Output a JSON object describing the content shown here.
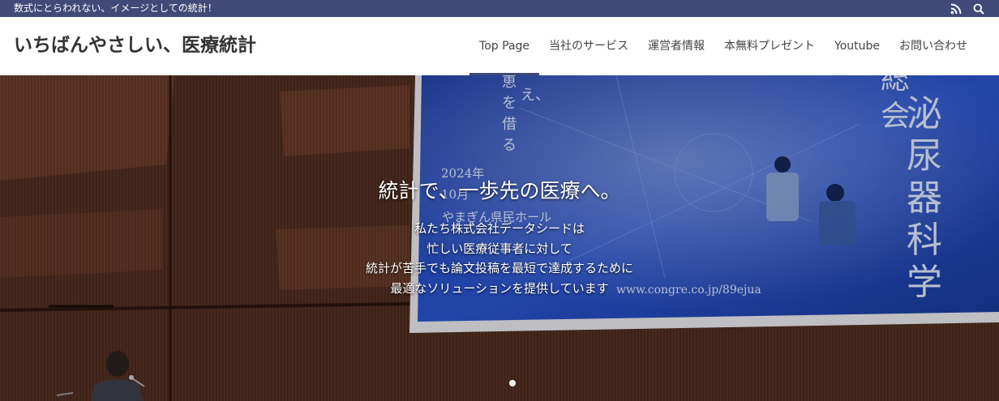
{
  "topbar": {
    "tagline": "数式にとらわれない、イメージとしての統計！",
    "icons": [
      "rss-icon",
      "search-icon"
    ]
  },
  "header": {
    "site_title": "いちばんやさしい、医療統計",
    "nav": [
      {
        "label": "Top Page",
        "active": true
      },
      {
        "label": "当社のサービス"
      },
      {
        "label": "運営者情報"
      },
      {
        "label": "本無料プレゼント"
      },
      {
        "label": "Youtube"
      },
      {
        "label": "お問い合わせ"
      }
    ]
  },
  "hero": {
    "heading": "統計で、一歩先の医療へ。",
    "lines": [
      "私たち株式会社データシードは",
      "忙しい医療従事者に対して",
      "統計が苦手でも論文投稿を最短で達成するために",
      "最適なソリューションを提供しています"
    ],
    "slider_dots": 1,
    "slide": {
      "screen_title_chars": [
        "泌",
        "尿",
        "器",
        "科",
        "学",
        "会"
      ],
      "screen_title_chars_2": [
        "総",
        "会"
      ],
      "screen_vertical": [
        "え、",
        "恵",
        "を",
        "借",
        "る"
      ],
      "screen_year": "2024年",
      "screen_month": "10月",
      "screen_venue": "やまぎん県民ホール",
      "screen_url": "www.congre.co.jp/89ejua"
    }
  },
  "colors": {
    "topbar": "#3f4a78",
    "nav_active_underline": "#3f4a78",
    "title": "#333333",
    "nav_text": "#444444"
  }
}
